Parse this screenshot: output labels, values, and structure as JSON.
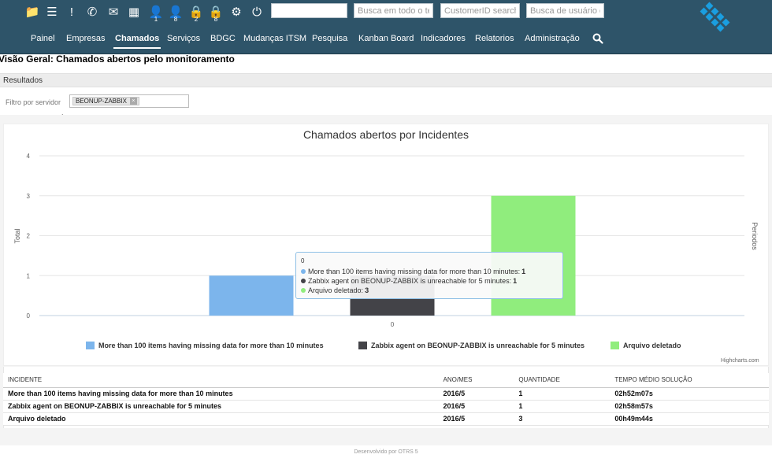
{
  "toolbar": {
    "icons": [
      {
        "name": "folder-icon",
        "glyph": "📁",
        "badge": ""
      },
      {
        "name": "list-icon",
        "glyph": "☰",
        "badge": ""
      },
      {
        "name": "exclamation-icon",
        "glyph": "!",
        "badge": ""
      },
      {
        "name": "phone-icon",
        "glyph": "✆",
        "badge": ""
      },
      {
        "name": "envelope-icon",
        "glyph": "✉",
        "badge": ""
      },
      {
        "name": "grid-icon",
        "glyph": "▦",
        "badge": ""
      },
      {
        "name": "user-clock-icon",
        "glyph": "👤",
        "badge": "1"
      },
      {
        "name": "user-icon",
        "glyph": "👤",
        "badge": "8"
      },
      {
        "name": "lock-clock-icon",
        "glyph": "🔒",
        "badge": "2"
      },
      {
        "name": "lock-icon",
        "glyph": "🔒",
        "badge": "8"
      },
      {
        "name": "gear-icon",
        "glyph": "⚙",
        "badge": ""
      },
      {
        "name": "power-icon",
        "glyph": "⏻",
        "badge": ""
      }
    ],
    "search_blank_value": "",
    "search_fulltext_placeholder": "Busca em todo o texto",
    "search_customerid_placeholder": "CustomerID search",
    "search_user_placeholder": "Busca de usuário cliente"
  },
  "nav": {
    "items": [
      "Painel",
      "Empresas",
      "Chamados",
      "Serviços",
      "BDGC",
      "Mudanças ITSM",
      "Pesquisa",
      "Kanban Board",
      "Indicadores",
      "Relatorios",
      "Administração"
    ],
    "active": "Chamados"
  },
  "page": {
    "title": "Visão Geral: Chamados abertos pelo monitoramento",
    "results_label": "Resultados",
    "filter_label": "Filtro por servidor",
    "filter_colon": ":",
    "filter_tag": "BEONUP-ZABBIX",
    "filter_tag_remove": "×"
  },
  "chart_data": {
    "type": "bar",
    "title": "Chamados abertos por Incidentes",
    "ylabel": "Total",
    "ylabel_right": "Periodos",
    "categories": [
      "0"
    ],
    "ylim": [
      0,
      4
    ],
    "yticks": [
      0,
      1,
      2,
      3,
      4
    ],
    "grid": true,
    "legend_position": "bottom-center",
    "series": [
      {
        "name": "More than 100 items having missing data for more than 10 minutes",
        "values": [
          1
        ],
        "color": "#7cb5ec"
      },
      {
        "name": "Zabbix agent on BEONUP-ZABBIX is unreachable for 5 minutes",
        "values": [
          1
        ],
        "color": "#434348"
      },
      {
        "name": "Arquivo deletado",
        "values": [
          3
        ],
        "color": "#90ed7d"
      }
    ],
    "credits": "Highcharts.com",
    "tooltip": {
      "header": "0",
      "rows": [
        {
          "label": "More than 100 items having missing data for more than 10 minutes:",
          "value": "1",
          "color": "#7cb5ec"
        },
        {
          "label": "Zabbix agent on BEONUP-ZABBIX is unreachable for 5 minutes:",
          "value": "1",
          "color": "#434348"
        },
        {
          "label": "Arquivo deletado:",
          "value": "3",
          "color": "#90ed7d"
        }
      ]
    }
  },
  "table": {
    "headers": [
      "INCIDENTE",
      "ANO/MES",
      "QUANTIDADE",
      "TEMPO MÉDIO SOLUÇÃO"
    ],
    "rows": [
      [
        "More than 100 items having missing data for more than 10 minutes",
        "2016/5",
        "1",
        "02h52m07s"
      ],
      [
        "Zabbix agent on BEONUP-ZABBIX is unreachable for 5 minutes",
        "2016/5",
        "1",
        "02h58m57s"
      ],
      [
        "Arquivo deletado",
        "2016/5",
        "3",
        "00h49m44s"
      ]
    ]
  },
  "footer": "Desenvolvido por OTRS 5",
  "colors": {
    "header_bg": "#2e5469",
    "logo": "#1a9ee0"
  }
}
